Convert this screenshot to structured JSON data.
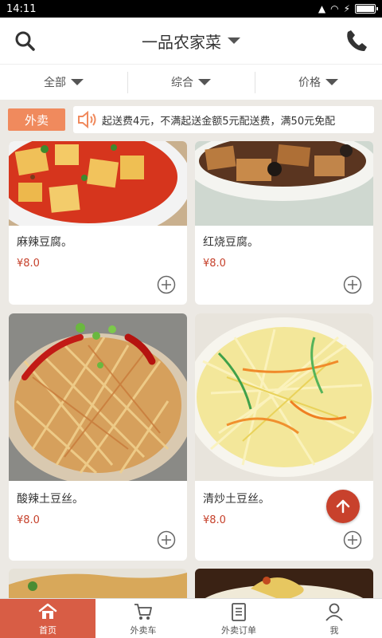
{
  "status_bar": {
    "time": "14:11"
  },
  "header": {
    "title": "一品农家菜"
  },
  "filters": [
    {
      "label": "全部"
    },
    {
      "label": "综合"
    },
    {
      "label": "价格"
    }
  ],
  "notice": {
    "tag": "外卖",
    "text": "起送费4元，不满起送金额5元配送费，满50元免配"
  },
  "products": [
    {
      "name": "麻辣豆腐。",
      "price": "¥8.0"
    },
    {
      "name": "红烧豆腐。",
      "price": "¥8.0"
    },
    {
      "name": "酸辣土豆丝。",
      "price": "¥8.0"
    },
    {
      "name": "清炒土豆丝。",
      "price": "¥8.0"
    }
  ],
  "tabbar": [
    {
      "label": "首页",
      "icon": "home-icon"
    },
    {
      "label": "外卖车",
      "icon": "cart-icon"
    },
    {
      "label": "外卖订单",
      "icon": "order-icon"
    },
    {
      "label": "我",
      "icon": "user-icon"
    }
  ],
  "colors": {
    "accent": "#c8412c",
    "tab_active": "#d85d45",
    "tag": "#f08a5d",
    "price": "#c6412b"
  }
}
